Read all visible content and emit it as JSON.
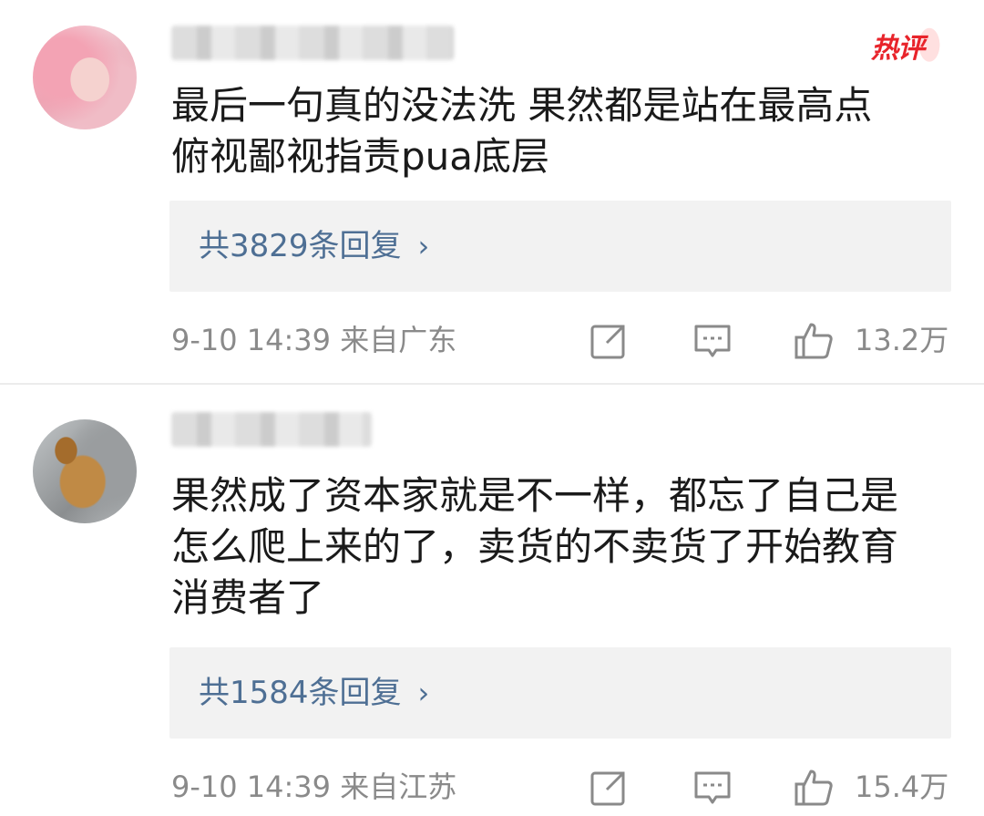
{
  "comments": [
    {
      "username": "",
      "badge": "热评",
      "text_lines": [
        "最后一句真的没法洗 果然都是站在最高点",
        "俯视鄙视指责pua底层"
      ],
      "replies_label": "共3829条回复",
      "time_location": "9-10 14:39  来自广东",
      "likes": "13.2万",
      "avatar_icon": "avatar-pink-hair",
      "icons": [
        "share-icon",
        "comment-icon",
        "like-icon"
      ]
    },
    {
      "username": "",
      "text_lines": [
        "果然成了资本家就是不一样，都忘了自己是",
        "怎么爬上来的了，卖货的不卖货了开始教育",
        "消费者了"
      ],
      "replies_label": "共1584条回复",
      "time_location": "9-10 14:39  来自江苏",
      "likes": "15.4万",
      "avatar_icon": "avatar-cat",
      "icons": [
        "share-icon",
        "comment-icon",
        "like-icon"
      ]
    }
  ],
  "colors": {
    "link": "#4e6f94",
    "hot": "#e8242b",
    "meta": "#8a8a8a",
    "reply_box": "#f2f2f2"
  }
}
